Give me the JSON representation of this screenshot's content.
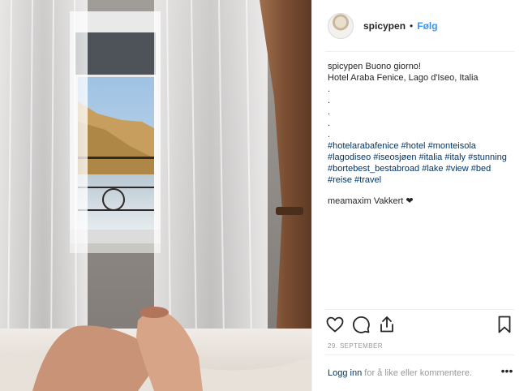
{
  "post": {
    "username": "spicypen",
    "separator": "•",
    "follow_label": "Følg"
  },
  "caption": {
    "username": "spicypen",
    "text_line1": "Buono giorno!",
    "text_line2": "Hotel Araba Fenice, Lago d'Iseo, Italia",
    "dots": [
      ".",
      ".",
      ".",
      ".",
      "."
    ],
    "hashtags_line1": [
      "#hotelarabafenice",
      "#hotel",
      "#monteisola"
    ],
    "hashtags_line2": [
      "#lagodiseo",
      "#iseosjøen",
      "#italia",
      "#italy",
      "#stunning"
    ],
    "hashtags_line3": [
      "#bortebest_bestabroad",
      "#lake",
      "#view",
      "#bed"
    ],
    "hashtags_line4": [
      "#reise",
      "#travel"
    ]
  },
  "comment": {
    "username": "meamaxim",
    "text": "Vakkert ❤"
  },
  "date": "29. SEPTEMBER",
  "footer": {
    "login_label": "Logg inn",
    "rest_text": "for å like eller kommentere.",
    "more_label": "•••"
  },
  "icons": {
    "like": "heart-icon",
    "comment": "comment-icon",
    "share": "share-icon",
    "save": "bookmark-icon",
    "more": "more-options-icon"
  },
  "colors": {
    "link": "#003569",
    "follow": "#3897f0",
    "muted": "#999999",
    "text": "#262626"
  }
}
